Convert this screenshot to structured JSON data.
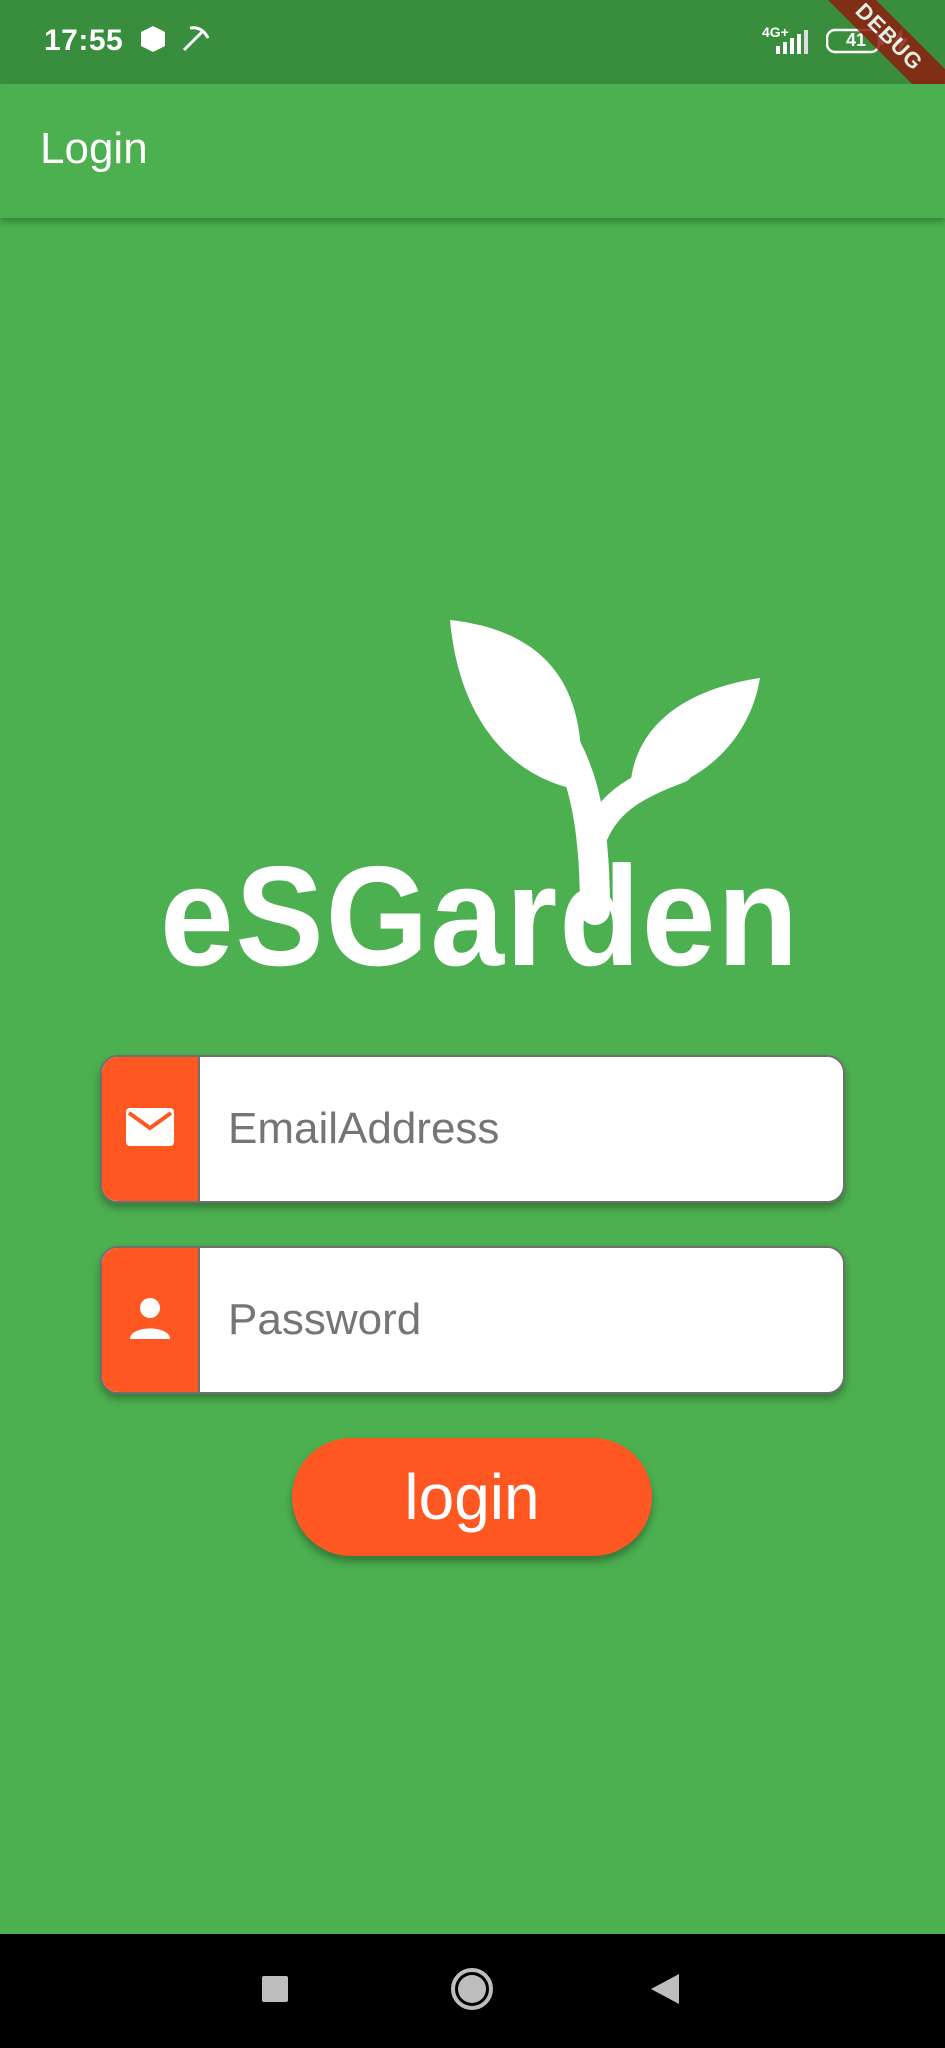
{
  "status_bar": {
    "time": "17:55",
    "network": "4G+",
    "battery": "41"
  },
  "debug_banner": "DEBUG",
  "app_bar": {
    "title": "Login"
  },
  "logo": {
    "text": "eSGarden"
  },
  "form": {
    "email": {
      "placeholder": "EmailAddress",
      "value": "",
      "icon": "mail-icon"
    },
    "password": {
      "placeholder": "Password",
      "value": "",
      "icon": "person-icon"
    },
    "login_label": "login"
  },
  "nav_bar": {
    "icons": [
      "recents-square-icon",
      "home-circle-icon",
      "back-triangle-icon"
    ]
  },
  "colors": {
    "primary": "#4CAF50",
    "status_bar": "#388E3C",
    "accent": "#FF5722"
  }
}
